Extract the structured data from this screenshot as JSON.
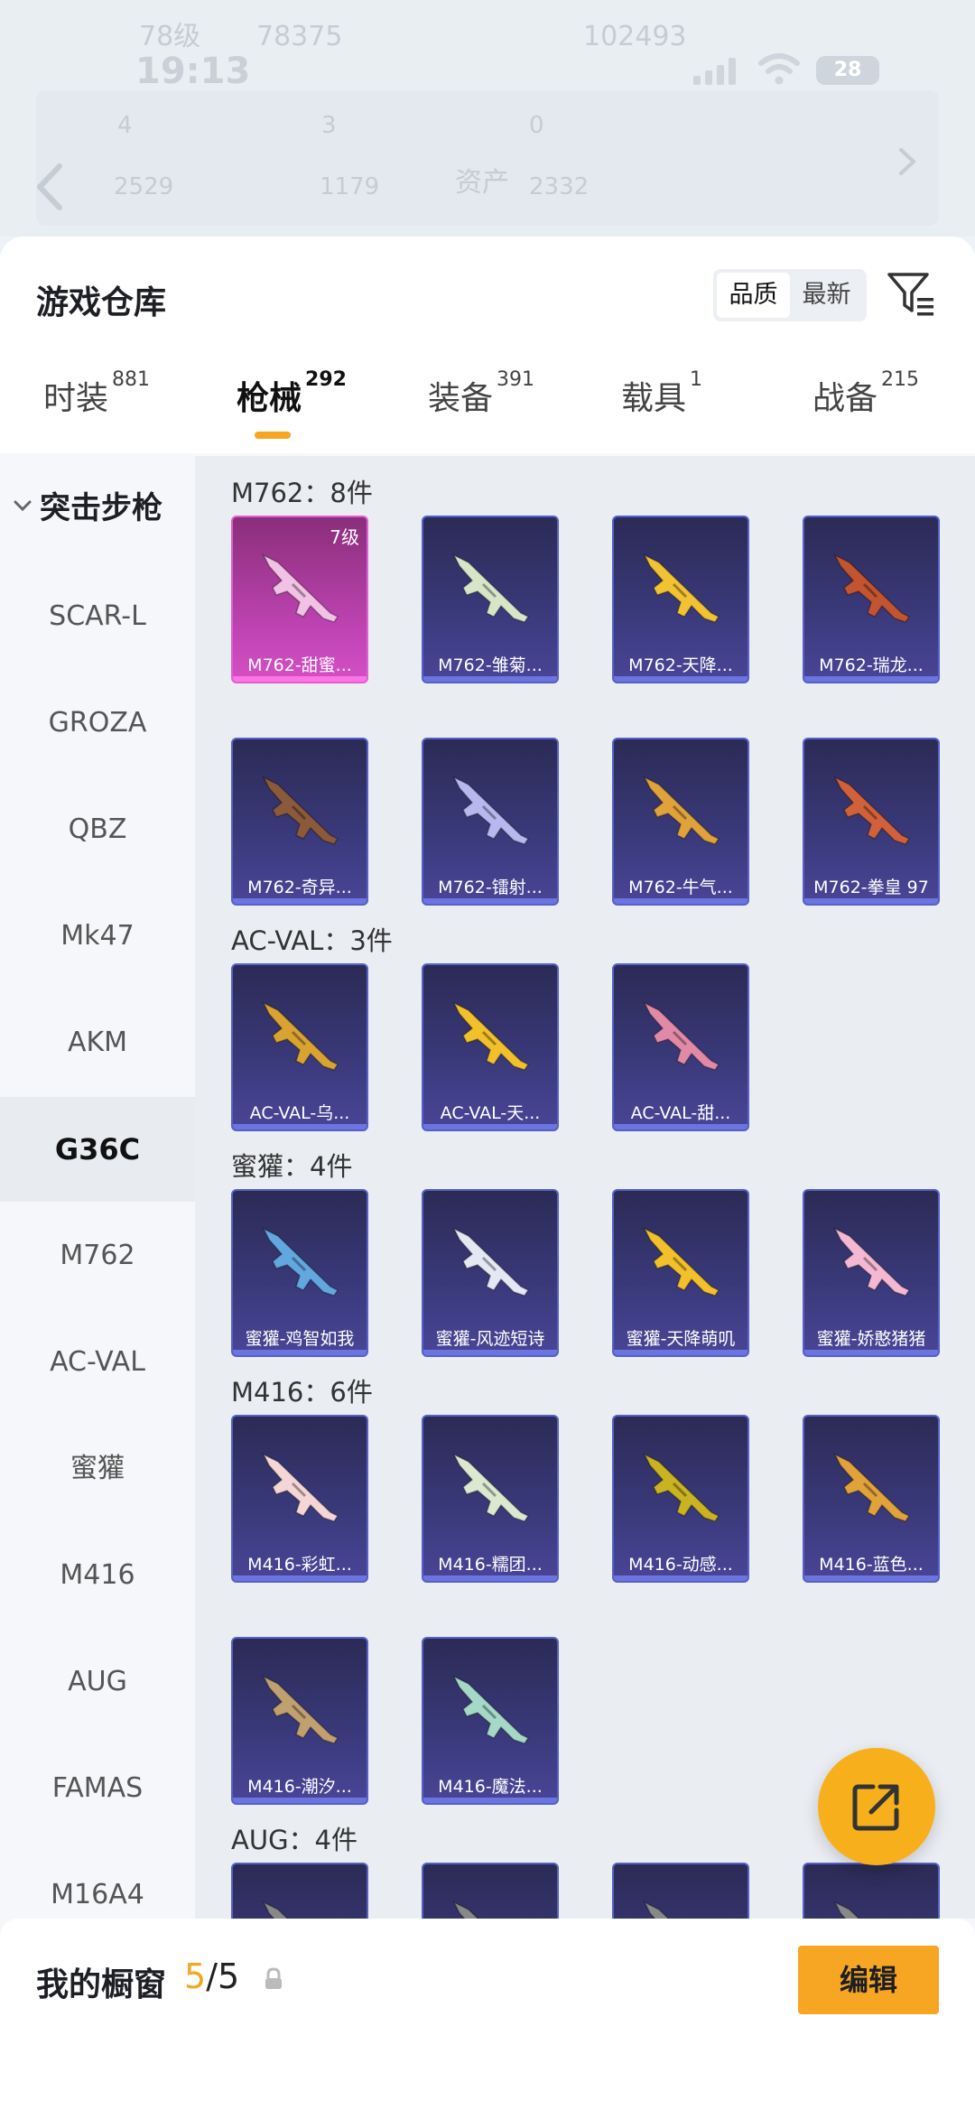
{
  "background": {
    "level_text": "78级",
    "coins_text": "78375",
    "right_value": "102493",
    "stats_row1": [
      "4",
      "3",
      "0"
    ],
    "stats_row2": [
      "2529",
      "1179"
    ],
    "asset_label": "资产",
    "asset_value": "2332"
  },
  "status": {
    "time": "19:13",
    "battery": "28"
  },
  "header": {
    "title": "游戏仓库",
    "sort_options": [
      "品质",
      "最新"
    ],
    "sort_selected": "品质"
  },
  "tabs": [
    {
      "label": "时装",
      "count": "881"
    },
    {
      "label": "枪械",
      "count": "292"
    },
    {
      "label": "装备",
      "count": "391"
    },
    {
      "label": "载具",
      "count": "1"
    },
    {
      "label": "战备",
      "count": "215"
    }
  ],
  "active_tab": "枪械",
  "sidebar": {
    "category": "突击步枪",
    "items": [
      "SCAR-L",
      "GROZA",
      "QBZ",
      "Mk47",
      "AKM",
      "G36C",
      "M762",
      "AC-VAL",
      "蜜獾",
      "M416",
      "AUG",
      "FAMAS",
      "M16A4"
    ],
    "selected": "G36C"
  },
  "groups": [
    {
      "title": "M762：8件",
      "items": [
        {
          "name": "M762-甜蜜...",
          "level": "7级",
          "rarity": "pink",
          "gun_color": "#f2c1e6"
        },
        {
          "name": "M762-雏菊...",
          "rarity": "purple",
          "gun_color": "#d8e6c8"
        },
        {
          "name": "M762-天降...",
          "rarity": "purple",
          "gun_color": "#f1c232"
        },
        {
          "name": "M762-瑞龙...",
          "rarity": "purple",
          "gun_color": "#c2542f"
        },
        {
          "name": "M762-奇异...",
          "rarity": "purple",
          "gun_color": "#8a5a3a"
        },
        {
          "name": "M762-镭射...",
          "rarity": "purple",
          "gun_color": "#b8b8f0"
        },
        {
          "name": "M762-牛气...",
          "rarity": "purple",
          "gun_color": "#e0a23a"
        },
        {
          "name": "M762-拳皇 97",
          "rarity": "purple",
          "gun_color": "#d0613b"
        }
      ]
    },
    {
      "title": "AC-VAL：3件",
      "items": [
        {
          "name": "AC-VAL-乌...",
          "rarity": "purple",
          "gun_color": "#d9a331"
        },
        {
          "name": "AC-VAL-天...",
          "rarity": "purple",
          "gun_color": "#f2c02a"
        },
        {
          "name": "AC-VAL-甜...",
          "rarity": "purple",
          "gun_color": "#e08aa8"
        }
      ]
    },
    {
      "title": "蜜獾：4件",
      "items": [
        {
          "name": "蜜獾-鸡智如我",
          "rarity": "purple",
          "gun_color": "#62a7e0"
        },
        {
          "name": "蜜獾-风迹短诗",
          "rarity": "purple",
          "gun_color": "#e4e8f4"
        },
        {
          "name": "蜜獾-天降萌叽",
          "rarity": "purple",
          "gun_color": "#f2c02a"
        },
        {
          "name": "蜜獾-娇憨猪猪",
          "rarity": "purple",
          "gun_color": "#f4b8d2"
        }
      ]
    },
    {
      "title": "M416：6件",
      "items": [
        {
          "name": "M416-彩虹...",
          "rarity": "purple",
          "gun_color": "#f4d6d6"
        },
        {
          "name": "M416-糯团...",
          "rarity": "purple",
          "gun_color": "#dce8d0"
        },
        {
          "name": "M416-动感...",
          "rarity": "purple",
          "gun_color": "#c9b320"
        },
        {
          "name": "M416-蓝色...",
          "rarity": "purple",
          "gun_color": "#e0a23a"
        },
        {
          "name": "M416-潮汐...",
          "rarity": "purple",
          "gun_color": "#c0a070"
        },
        {
          "name": "M416-魔法...",
          "rarity": "purple",
          "gun_color": "#a6d8c8"
        }
      ]
    },
    {
      "title": "AUG：4件",
      "items": [
        {
          "name": "",
          "rarity": "purple",
          "gun_color": "#888"
        },
        {
          "name": "",
          "rarity": "purple",
          "gun_color": "#888"
        },
        {
          "name": "",
          "rarity": "purple",
          "gun_color": "#888"
        },
        {
          "name": "",
          "rarity": "purple",
          "gun_color": "#888"
        }
      ]
    }
  ],
  "showcase": {
    "label": "我的橱窗",
    "current": "5",
    "total": "/5",
    "edit_label": "编辑"
  },
  "colors": {
    "accent": "#f6a623",
    "card_purple": "#3a3a7c",
    "card_pink": "#c044b5"
  },
  "icons": [
    "back-chevron-icon",
    "filter-icon",
    "share-icon",
    "lock-icon",
    "chevron-down-icon"
  ]
}
